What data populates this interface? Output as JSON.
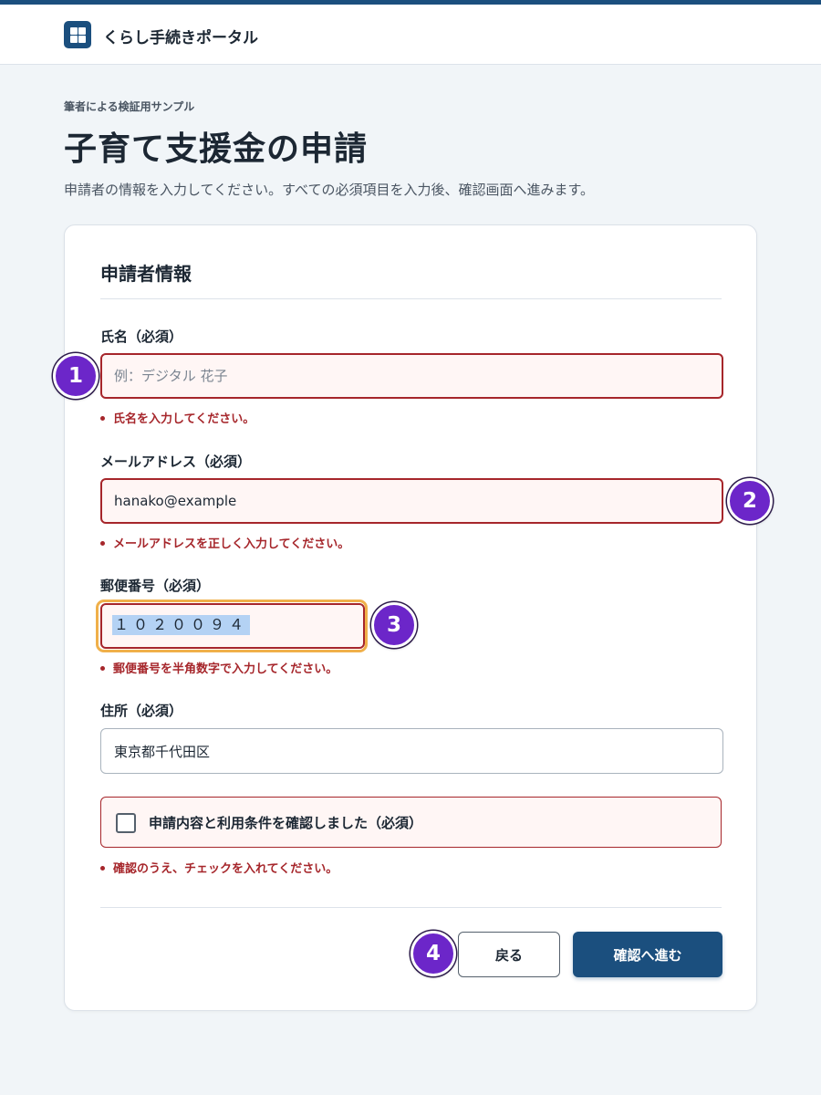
{
  "header": {
    "app_title": "くらし手続きポータル",
    "logo_icon": "grid-icon"
  },
  "page": {
    "eyebrow": "筆者による検証用サンプル",
    "title": "子育て支援金の申請",
    "description": "申請者の情報を入力してください。すべての必須項目を入力後、確認画面へ進みます。"
  },
  "form": {
    "section_title": "申請者情報",
    "name": {
      "label": "氏名（必須）",
      "placeholder": "例：デジタル 花子",
      "value": "",
      "error": "氏名を入力してください。"
    },
    "email": {
      "label": "メールアドレス（必須）",
      "value": "hanako@example",
      "error": "メールアドレスを正しく入力してください。"
    },
    "postal": {
      "label": "郵便番号（必須）",
      "value": "１０２００９４",
      "error": "郵便番号を半角数字で入力してください。"
    },
    "address": {
      "label": "住所（必須）",
      "value": "東京都千代田区"
    },
    "consent": {
      "label": "申請内容と利用条件を確認しました（必須）",
      "checked": false,
      "error": "確認のうえ、チェックを入れてください。"
    },
    "back_label": "戻る",
    "next_label": "確認へ進む"
  },
  "markers": [
    "1",
    "2",
    "3",
    "4"
  ],
  "colors": {
    "brand": "#1b4f7e",
    "error": "#a6262b",
    "error_bg": "#fff6f5",
    "focus": "#f0b04a",
    "marker": "#6c26c9"
  }
}
